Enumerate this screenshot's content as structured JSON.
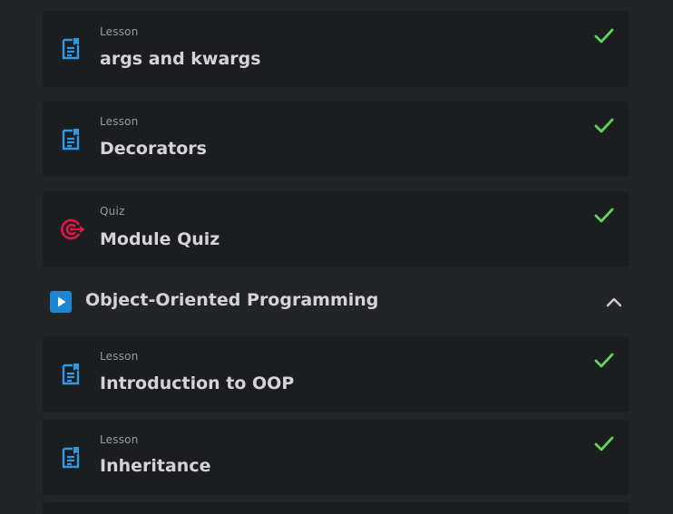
{
  "items": [
    {
      "kind": "Lesson",
      "title": "args and kwargs",
      "icon": "document-icon",
      "completed": true
    },
    {
      "kind": "Lesson",
      "title": "Decorators",
      "icon": "document-icon",
      "completed": true
    },
    {
      "kind": "Quiz",
      "title": "Module Quiz",
      "icon": "target-icon",
      "completed": true
    }
  ],
  "module": {
    "title": "Object-Oriented Programming",
    "icon": "play-icon",
    "expanded": true,
    "items": [
      {
        "kind": "Lesson",
        "title": "Introduction to OOP",
        "icon": "document-icon",
        "completed": true
      },
      {
        "kind": "Lesson",
        "title": "Inheritance",
        "icon": "document-icon",
        "completed": true
      }
    ]
  },
  "colors": {
    "background": "#232425",
    "card": "#1c1d1f",
    "lesson_icon": "#2c9ae8",
    "quiz_icon": "#e5154b",
    "check": "#5fd35c",
    "module_icon": "#1d86d2"
  }
}
